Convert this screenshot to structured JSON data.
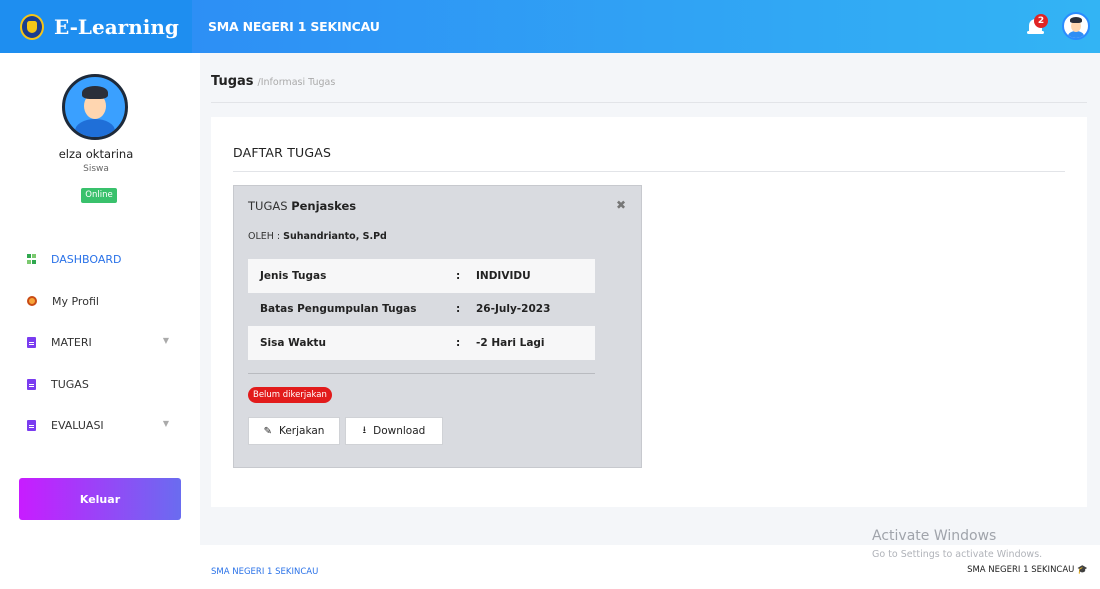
{
  "header": {
    "brand": "E-Learning",
    "school": "SMA NEGERI 1 SEKINCAU",
    "notification_count": "2",
    "notification_icon": "bell-icon",
    "accent": "#2d8ff5"
  },
  "sidebar": {
    "user_name": "elza oktarina",
    "user_role": "Siswa",
    "status": "Online",
    "items": [
      {
        "label": "DASHBOARD",
        "icon": "dashboard-icon",
        "active": true
      },
      {
        "label": "My Profil",
        "icon": "profile-icon"
      },
      {
        "label": "MATERI",
        "icon": "document-icon",
        "has_caret": true
      },
      {
        "label": "TUGAS",
        "icon": "document-icon"
      },
      {
        "label": "EVALUASI",
        "icon": "document-icon",
        "has_caret": true
      }
    ],
    "logout_label": "Keluar"
  },
  "breadcrumb": {
    "title": "Tugas",
    "separator": "/",
    "subtitle": "Informasi Tugas"
  },
  "card": {
    "title": "DAFTAR TUGAS"
  },
  "task": {
    "title_prefix": "TUGAS",
    "subject": "Penjaskes",
    "author_prefix": "OLEH :",
    "author": "Suhandrianto, S.Pd",
    "rows": [
      {
        "label": "Jenis Tugas",
        "colon": ":",
        "value": "INDIVIDU"
      },
      {
        "label": "Batas Pengumpulan Tugas",
        "colon": ":",
        "value": "26-July-2023"
      },
      {
        "label": "Sisa Waktu",
        "colon": ":",
        "value": "-2 Hari Lagi"
      }
    ],
    "status": "Belum dikerjakan",
    "status_color": "#e21b1b",
    "buttons": {
      "work_label": "Kerjakan",
      "download_label": "Download"
    }
  },
  "footer": {
    "left": "SMA NEGERI 1 SEKINCAU",
    "right": "SMA NEGERI 1 SEKINCAU"
  },
  "watermark": {
    "title": "Activate Windows",
    "subtitle": "Go to Settings to activate Windows."
  }
}
